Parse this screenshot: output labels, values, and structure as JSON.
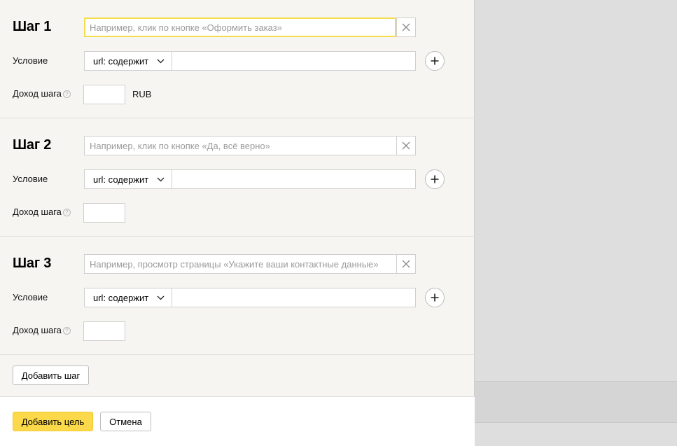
{
  "steps": [
    {
      "title": "Шаг 1",
      "name_placeholder": "Например, клик по кнопке «Оформить заказ»",
      "name_value": "",
      "condition_label": "Условие",
      "condition_type": "url: содержит",
      "condition_value": "",
      "income_label": "Доход шага",
      "income_value": "",
      "currency": "RUB"
    },
    {
      "title": "Шаг 2",
      "name_placeholder": "Например, клик по кнопке «Да, всё верно»",
      "name_value": "",
      "condition_label": "Условие",
      "condition_type": "url: содержит",
      "condition_value": "",
      "income_label": "Доход шага",
      "income_value": ""
    },
    {
      "title": "Шаг 3",
      "name_placeholder": "Например, просмотр страницы «Укажите ваши контактные данные»",
      "name_value": "",
      "condition_label": "Условие",
      "condition_type": "url: содержит",
      "condition_value": "",
      "income_label": "Доход шага",
      "income_value": ""
    }
  ],
  "help_glyph": "?",
  "add_step_label": "Добавить шаг",
  "footer": {
    "submit_label": "Добавить цель",
    "cancel_label": "Отмена"
  },
  "colors": {
    "accent_yellow": "#fcd94a",
    "focus_border": "#f5dc4c",
    "panel_bg": "#f6f5f2",
    "overlay_bg": "#dedede"
  },
  "icons": {
    "clear": "close-icon",
    "add_condition": "plus-icon",
    "dropdown": "chevron-down-icon",
    "help": "help-icon"
  }
}
